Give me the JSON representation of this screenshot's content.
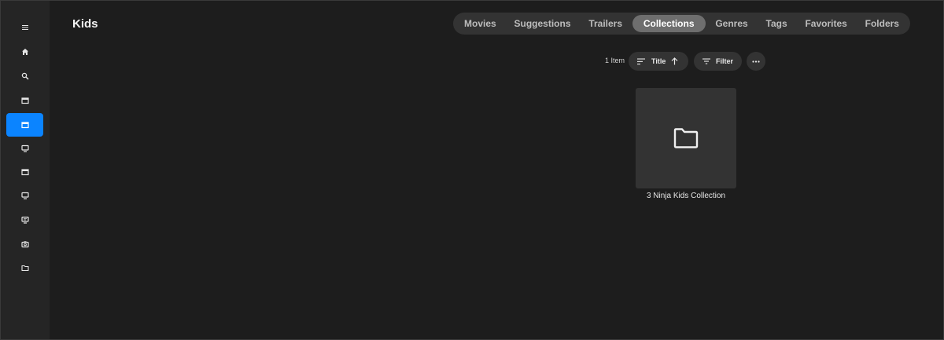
{
  "header": {
    "title": "Kids"
  },
  "sidebar": {
    "items": [
      {
        "icon": "menu-icon",
        "active": false
      },
      {
        "icon": "home-icon",
        "active": false
      },
      {
        "icon": "search-icon",
        "active": false
      },
      {
        "icon": "movie-icon",
        "active": false
      },
      {
        "icon": "movie-icon",
        "active": true
      },
      {
        "icon": "tv-icon",
        "active": false
      },
      {
        "icon": "movie-icon",
        "active": false
      },
      {
        "icon": "tv-icon",
        "active": false
      },
      {
        "icon": "live-tv-icon",
        "active": false
      },
      {
        "icon": "camera-icon",
        "active": false
      },
      {
        "icon": "folder-icon",
        "active": false
      }
    ],
    "active_color": "#0b84ff"
  },
  "tabs": [
    {
      "label": "Movies",
      "active": false
    },
    {
      "label": "Suggestions",
      "active": false
    },
    {
      "label": "Trailers",
      "active": false
    },
    {
      "label": "Collections",
      "active": true
    },
    {
      "label": "Genres",
      "active": false
    },
    {
      "label": "Tags",
      "active": false
    },
    {
      "label": "Favorites",
      "active": false
    },
    {
      "label": "Folders",
      "active": false
    }
  ],
  "toolbar": {
    "count_label": "1 Item",
    "sort_label": "Title",
    "sort_icon": "sort-icon",
    "sort_direction_icon": "arrow-up-icon",
    "filter_label": "Filter",
    "filter_icon": "filter-icon",
    "more_icon": "more-horizontal-icon"
  },
  "items": [
    {
      "title": "3 Ninja Kids Collection",
      "icon": "folder-icon"
    }
  ]
}
